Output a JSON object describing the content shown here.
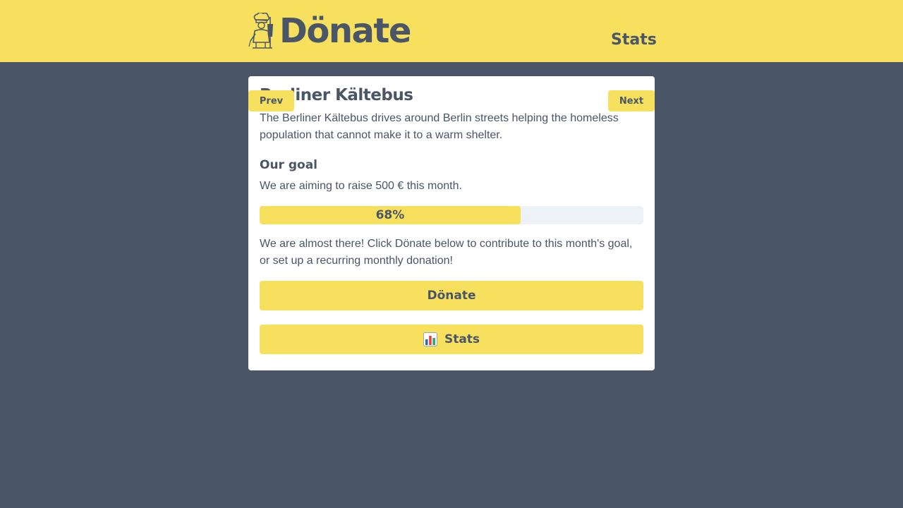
{
  "header": {
    "logo_text": "Dönate",
    "nav_stats_label": "Stats"
  },
  "pager": {
    "prev_label": "Prev",
    "next_label": "Next"
  },
  "campaign": {
    "title": "Berliner Kältebus",
    "description": "The Berliner Kältebus drives around Berlin streets helping the homeless population that cannot make it to a warm shelter.",
    "goal_heading": "Our goal",
    "goal_text": "We are aiming to raise 500 € this month.",
    "progress_percent": 68,
    "progress_label": "68%",
    "cta_text": "We are almost there! Click Dönate below to contribute to this month's goal, or set up a recurring monthly donation!",
    "donate_button_label": "Dönate",
    "stats_button_label": "Stats",
    "stats_button_icon": "bar-chart-icon"
  },
  "colors": {
    "accent": "#f6e05e",
    "background": "#4a5568",
    "text": "#4a5568",
    "card": "#ffffff",
    "progress_track": "#edf2f7"
  }
}
